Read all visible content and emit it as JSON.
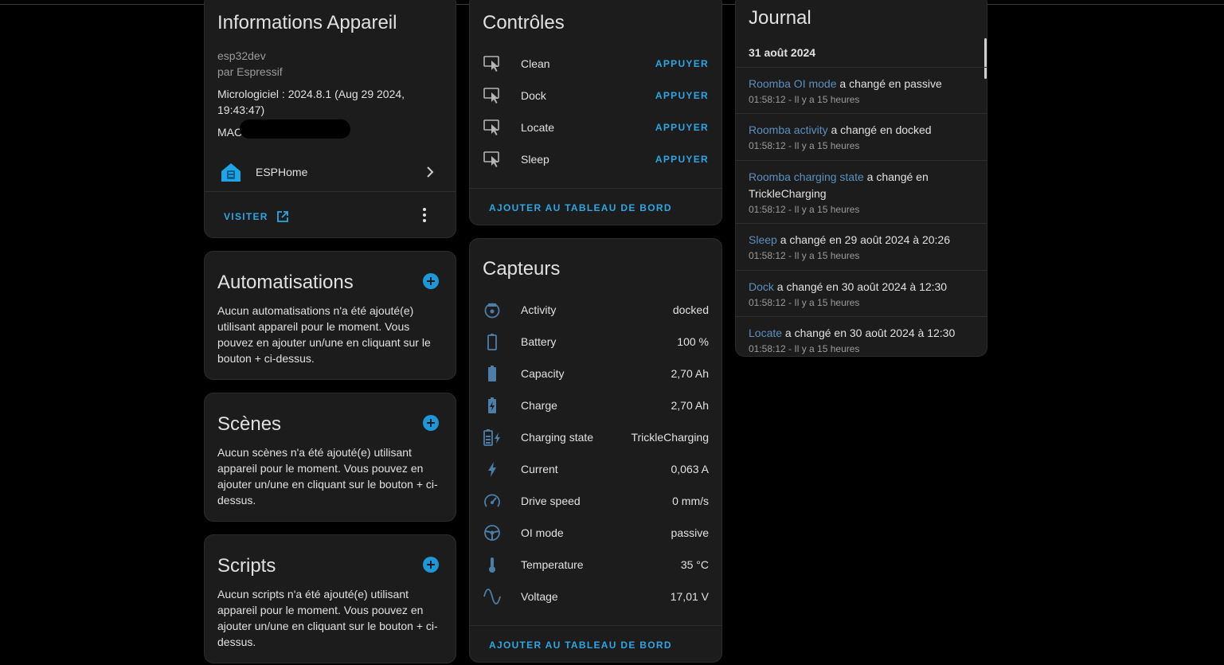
{
  "device_info": {
    "title": "Informations Appareil",
    "model": "esp32dev",
    "manufacturer": "par Espressif",
    "firmware": "Micrologiciel : 2024.8.1 (Aug 29 2024, 19:43:47)",
    "mac_label": "MAC",
    "integration": "ESPHome",
    "visit_label": "VISITER"
  },
  "automations": {
    "title": "Automatisations",
    "text": "Aucun automatisations n'a été ajouté(e) utilisant appareil pour le moment. Vous pouvez en ajouter un/une en cliquant sur le bouton + ci-dessus."
  },
  "scenes": {
    "title": "Scènes",
    "text": "Aucun scènes n'a été ajouté(e) utilisant appareil pour le moment. Vous pouvez en ajouter un/une en cliquant sur le bouton + ci-dessus."
  },
  "scripts": {
    "title": "Scripts",
    "text": "Aucun scripts n'a été ajouté(e) utilisant appareil pour le moment. Vous pouvez en ajouter un/une en cliquant sur le bouton + ci-dessus."
  },
  "controls": {
    "title": "Contrôles",
    "items": [
      {
        "name": "Clean",
        "action": "APPUYER",
        "icon": "button-press-icon"
      },
      {
        "name": "Dock",
        "action": "APPUYER",
        "icon": "button-press-icon"
      },
      {
        "name": "Locate",
        "action": "APPUYER",
        "icon": "button-press-icon"
      },
      {
        "name": "Sleep",
        "action": "APPUYER",
        "icon": "button-press-icon"
      }
    ],
    "add_label": "AJOUTER AU TABLEAU DE BORD"
  },
  "sensors": {
    "title": "Capteurs",
    "items": [
      {
        "name": "Activity",
        "value": "docked",
        "icon": "robot-vacuum-icon"
      },
      {
        "name": "Battery",
        "value": "100 %",
        "icon": "battery-outline-icon"
      },
      {
        "name": "Capacity",
        "value": "2,70 Ah",
        "icon": "battery-full-icon"
      },
      {
        "name": "Charge",
        "value": "2,70 Ah",
        "icon": "battery-charging-icon"
      },
      {
        "name": "Charging state",
        "value": "TrickleCharging",
        "icon": "battery-charging-state-icon"
      },
      {
        "name": "Current",
        "value": "0,063 A",
        "icon": "flash-icon"
      },
      {
        "name": "Drive speed",
        "value": "0 mm/s",
        "icon": "speedometer-icon"
      },
      {
        "name": "OI mode",
        "value": "passive",
        "icon": "steering-icon"
      },
      {
        "name": "Temperature",
        "value": "35 °C",
        "icon": "thermometer-icon"
      },
      {
        "name": "Voltage",
        "value": "17,01 V",
        "icon": "sine-wave-icon"
      }
    ],
    "add_label": "AJOUTER AU TABLEAU DE BORD"
  },
  "journal": {
    "title": "Journal",
    "date": "31 août 2024",
    "entries": [
      {
        "entity": "Roomba OI mode",
        "text": " a changé en passive",
        "time": "01:58:12 - Il y a 15 heures"
      },
      {
        "entity": "Roomba activity",
        "text": " a changé en docked",
        "time": "01:58:12 - Il y a 15 heures"
      },
      {
        "entity": "Roomba charging state",
        "text": " a changé en TrickleCharging",
        "time": "01:58:12 - Il y a 15 heures"
      },
      {
        "entity": "Sleep",
        "text": " a changé en 29 août 2024 à 20:26",
        "time": "01:58:12 - Il y a 15 heures"
      },
      {
        "entity": "Dock",
        "text": " a changé en 30 août 2024 à 12:30",
        "time": "01:58:12 - Il y a 15 heures"
      },
      {
        "entity": "Locate",
        "text": " a changé en 30 août 2024 à 12:30",
        "time": "01:58:12 - Il y a 15 heures"
      }
    ]
  },
  "colors": {
    "accent": "#2ea6e3",
    "card_bg": "#1c1c1c",
    "icon": "#4d7ea8",
    "link": "#5c8fc0"
  }
}
